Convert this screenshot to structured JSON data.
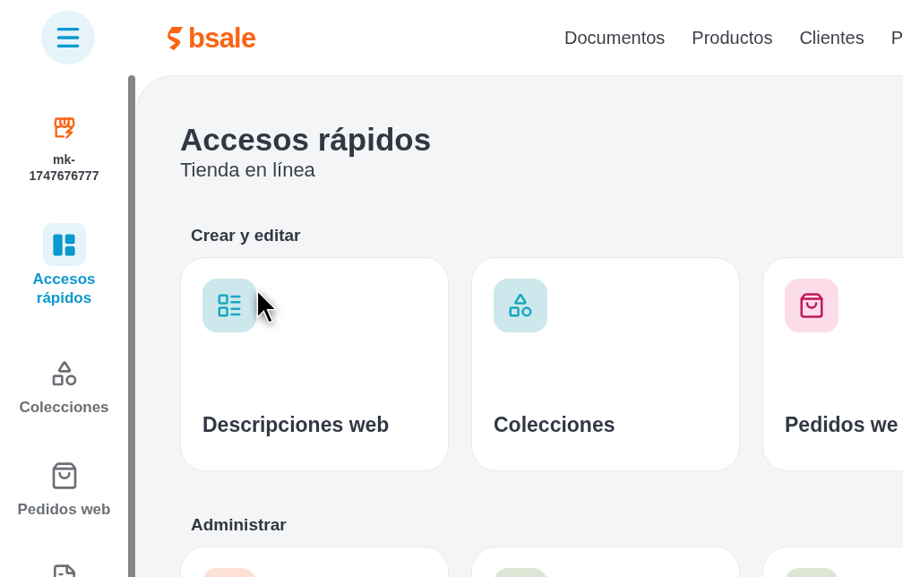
{
  "header": {
    "logo": "bsale",
    "nav": [
      {
        "label": "Documentos"
      },
      {
        "label": "Productos"
      },
      {
        "label": "Clientes"
      },
      {
        "label": "P"
      }
    ]
  },
  "sidebar": {
    "account": "mk-1747676777",
    "items": [
      {
        "kind": "dashboard",
        "label": "Accesos rápidos",
        "selected": true
      },
      {
        "kind": "shapes",
        "label": "Colecciones",
        "selected": false
      },
      {
        "kind": "bag",
        "label": "Pedidos web",
        "selected": false
      },
      {
        "kind": "document",
        "selected": false
      }
    ]
  },
  "page": {
    "title": "Accesos rápidos",
    "subtitle": "Tienda en línea"
  },
  "sections": [
    {
      "title": "Crear y editar",
      "cards": [
        {
          "kind": "list",
          "label": "Descripciones web",
          "color": "#cde8ec"
        },
        {
          "kind": "shapes",
          "label": "Colecciones",
          "color": "#cde8ec"
        },
        {
          "kind": "bag",
          "label": "Pedidos we",
          "color": "#fddce9"
        }
      ]
    },
    {
      "title": "Administrar",
      "cards": [
        {
          "kind": "blank",
          "color": "#fde0d6"
        },
        {
          "kind": "blank",
          "color": "#dde6d4"
        },
        {
          "kind": "blank",
          "color": "#dde6d4"
        }
      ]
    }
  ]
}
